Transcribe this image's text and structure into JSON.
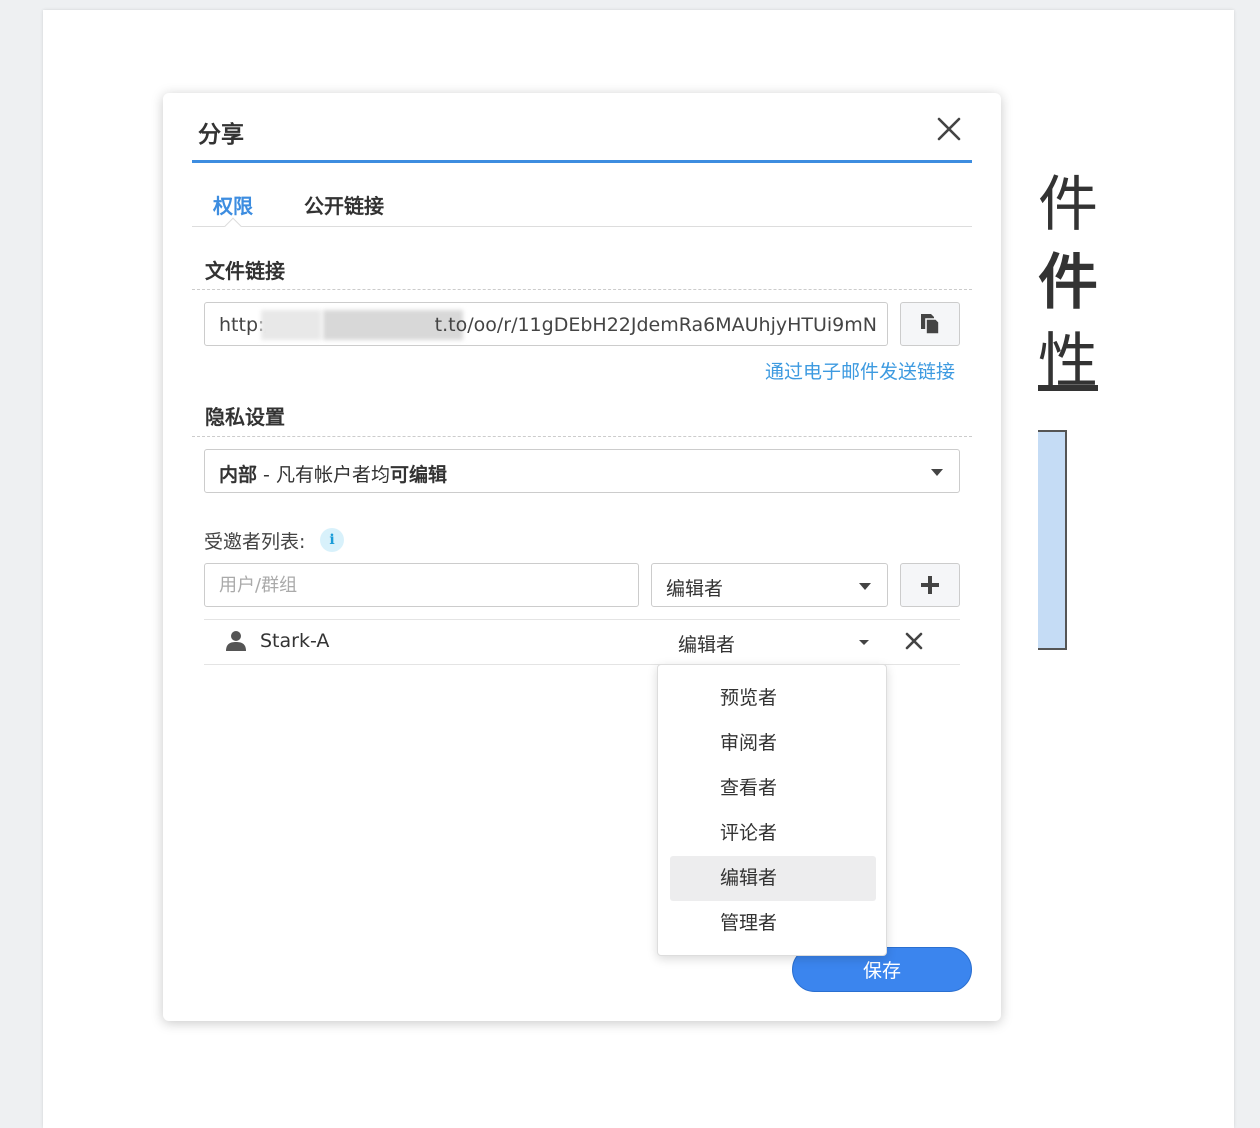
{
  "background_doc": {
    "text_line_1": "件",
    "text_line_2": "件",
    "text_line_3": "性"
  },
  "dialog": {
    "title": "分享",
    "tabs": [
      {
        "label": "权限",
        "active": true
      },
      {
        "label": "公开链接",
        "active": false
      }
    ],
    "file_link": {
      "section_title": "文件链接",
      "url_prefix": "http:/",
      "url_suffix": "t.to/oo/r/11gDEbH22JdemRa6MAUhjyHTUi9mN",
      "send_email_label": "通过电子邮件发送链接"
    },
    "privacy": {
      "section_title": "隐私设置",
      "selected_bold": "内部",
      "selected_middle": " - 凡有帐户者均",
      "selected_bold_end": "可编辑"
    },
    "invitees": {
      "label": "受邀者列表:",
      "user_placeholder": "用户/群组",
      "role_selected": "编辑者",
      "rows": [
        {
          "name": "Stark-A",
          "role": "编辑者"
        }
      ]
    },
    "role_dropdown": {
      "options": [
        "预览者",
        "审阅者",
        "查看者",
        "评论者",
        "编辑者",
        "管理者"
      ],
      "highlighted": "编辑者"
    },
    "save_label": "保存"
  },
  "colors": {
    "accent": "#3d8de0",
    "save_button": "#3b85ee",
    "link": "#3d9ae0"
  }
}
